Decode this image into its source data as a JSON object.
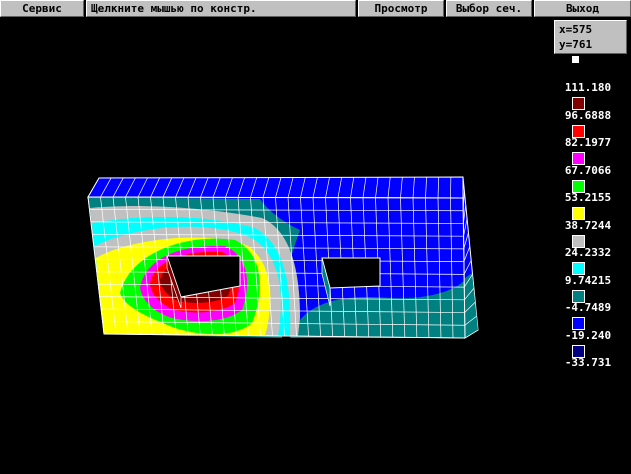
{
  "menu": {
    "service": "Сервис",
    "hint": "Щелкните мышью по констр.",
    "view": "Просмотр",
    "section": "Выбор сеч.",
    "exit": "Выход"
  },
  "coords": {
    "x": "x=575",
    "y": "y=761"
  },
  "legend": {
    "top_swatch_color": "#ffffff",
    "items": [
      {
        "value": "111.180",
        "color": "#800000"
      },
      {
        "value": "96.6888",
        "color": "#ff0000"
      },
      {
        "value": "82.1977",
        "color": "#ff00ff"
      },
      {
        "value": "67.7066",
        "color": "#00ff00"
      },
      {
        "value": "53.2155",
        "color": "#ffff00"
      },
      {
        "value": "38.7244",
        "color": "#c0c0c0"
      },
      {
        "value": "24.2332",
        "color": "#00ffff"
      },
      {
        "value": "9.74215",
        "color": "#008080"
      },
      {
        "value": "-4.7489",
        "color": "#0000ff"
      },
      {
        "value": "-19.240",
        "color": "#000080"
      },
      {
        "value": "-33.731",
        "color": ""
      }
    ]
  },
  "palette": {
    "background": "#000000",
    "grid_line": "#ffffff",
    "menu_face": "#c0c0c0"
  }
}
